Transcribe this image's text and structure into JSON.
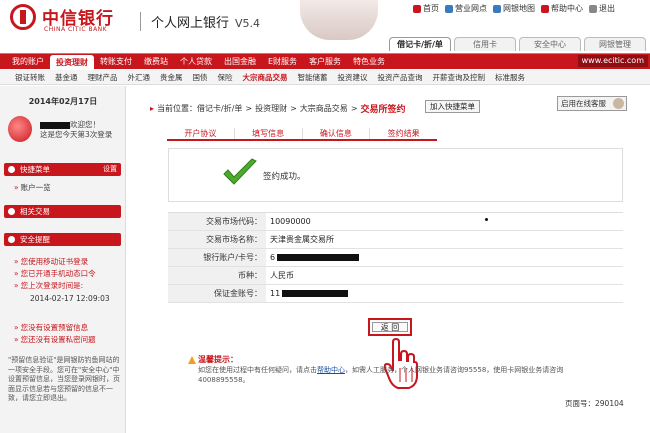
{
  "header": {
    "bank_name": "中信银行",
    "bank_name_en": "CHINA CITIC BANK",
    "product": "个人网上银行",
    "version": "V5.4",
    "links": [
      {
        "label": "首页",
        "icon": "home-icon"
      },
      {
        "label": "营业网点",
        "icon": "building-icon"
      },
      {
        "label": "网银地图",
        "icon": "map-icon"
      },
      {
        "label": "帮助中心",
        "icon": "help-icon"
      },
      {
        "label": "退出",
        "icon": "exit-icon"
      }
    ],
    "tabs": [
      "借记卡/折/单",
      "信用卡",
      "安全中心",
      "网银管理"
    ],
    "active_tab": "借记卡/折/单",
    "url": "www.ecitic.com"
  },
  "nav": {
    "items": [
      "我的账户",
      "投资理财",
      "转账支付",
      "缴费站",
      "个人贷款",
      "出国金融",
      "E财服务",
      "客户服务",
      "特色业务"
    ],
    "active": "投资理财"
  },
  "subnav": {
    "items": [
      "银证转账",
      "基金通",
      "理财产品",
      "外汇通",
      "贵金属",
      "国债",
      "保险",
      "大宗商品交易",
      "智能储蓄",
      "投资建议",
      "投资产品查询",
      "开薪查询及控制",
      "标准服务"
    ],
    "active": "大宗商品交易"
  },
  "sidebar": {
    "date": "2014年02月17日",
    "welcome_line1": "欢迎您！",
    "welcome_line2": "这是您今天第3次登录",
    "quick_menu": "快捷菜单",
    "quick_setting": "设置",
    "quick_items": [
      "账户一览"
    ],
    "related": "相关交易",
    "security": "安全提醒",
    "security_items": [
      "您使用移动证书登录",
      "您已开通手机动态口令",
      "您上次登录时间是:"
    ],
    "last_login": "2014-02-17 12:09:03",
    "warning_items": [
      "您没有设置预留信息",
      "您还没有设置私密问题"
    ],
    "notice": "\"预留信息验证\"是网银防钓鱼网站的一项安全手段。您可在\"安全中心\"中设置预留信息，当您登录网银时，页面显示信息若与您预留的信息不一致，请您立即退出。"
  },
  "main": {
    "breadcrumb": [
      "当前位置：借记卡/折/单",
      "投资理财",
      "大宗商品交易",
      "交易所签约"
    ],
    "quick_add": "加入快捷菜单",
    "online_service": "启用在线客服",
    "steps": [
      "开户协议",
      "填写信息",
      "确认信息",
      "签约结果"
    ],
    "success": "签约成功。",
    "rows": [
      {
        "label": "交易市场代码：",
        "value": "10090000"
      },
      {
        "label": "交易市场名称：",
        "value": "天津贵金属交易所"
      },
      {
        "label": "银行账户/卡号：",
        "value": "6"
      },
      {
        "label": "币种：",
        "value": "人民币"
      },
      {
        "label": "保证金账号：",
        "value": "11"
      }
    ],
    "back_button": "返 回",
    "tips_title": "温馨提示：",
    "tips_text_a": "如您在使用过程中有任何疑问，请点击",
    "tips_link": "帮助中心",
    "tips_text_b": "，如需人工服务，个人网银业务请咨询95558，使用卡网银业务请咨询4008895558。",
    "page_no": "页面号：290104"
  }
}
